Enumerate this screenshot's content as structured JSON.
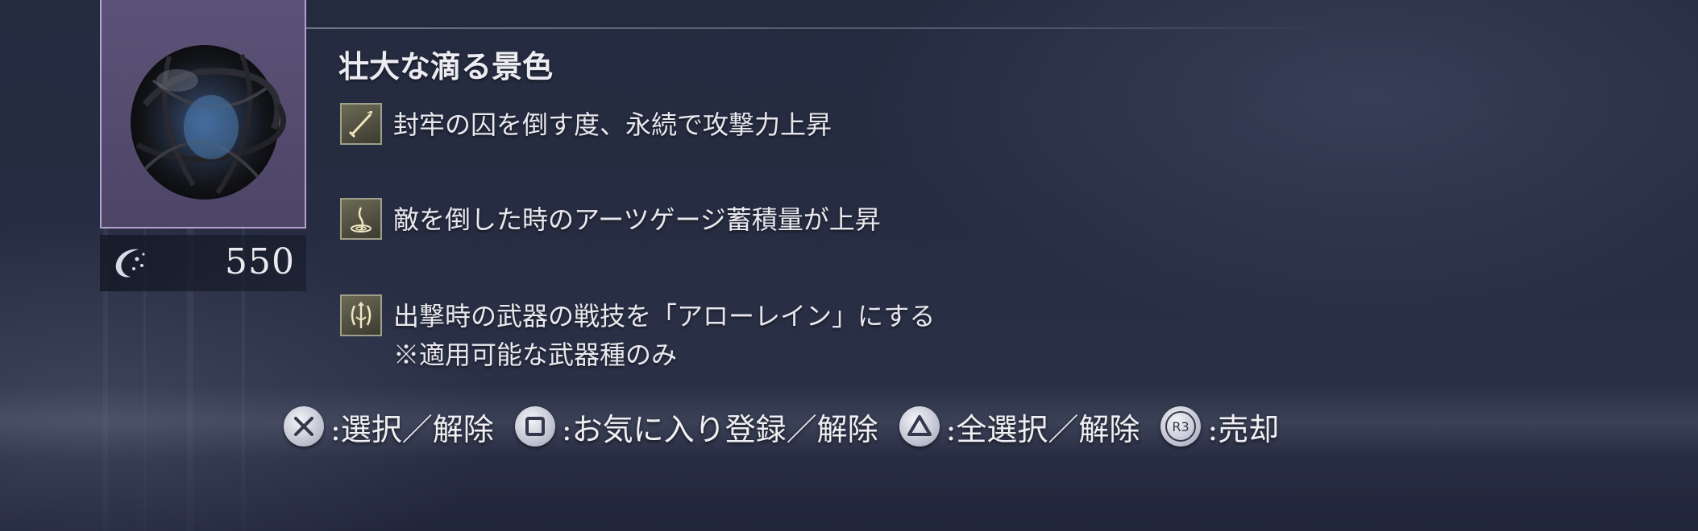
{
  "item": {
    "name": "壮大な滴る景色",
    "cost": "550",
    "image_icon": "dark-tangled-orb",
    "cost_icon": "currency-icon",
    "frame_color": "#b4a3d0"
  },
  "effects": [
    {
      "icon": "sword-attack-icon",
      "text": "封牢の囚を倒す度、永続で攻撃力上昇",
      "note": ""
    },
    {
      "icon": "arts-gauge-icon",
      "text": "敵を倒した時のアーツゲージ蓄積量が上昇",
      "note": ""
    },
    {
      "icon": "weapon-skill-icon",
      "text": "出撃時の武器の戦技を「アローレイン」にする",
      "note": "※適用可能な武器種のみ"
    }
  ],
  "controls": [
    {
      "button": "cross-button-icon",
      "label": ":選択／解除"
    },
    {
      "button": "square-button-icon",
      "label": ":お気に入り登録／解除"
    },
    {
      "button": "triangle-button-icon",
      "label": ":全選択／解除"
    },
    {
      "button": "r3-button-icon",
      "button_text": "R3",
      "label": ":売却"
    }
  ]
}
